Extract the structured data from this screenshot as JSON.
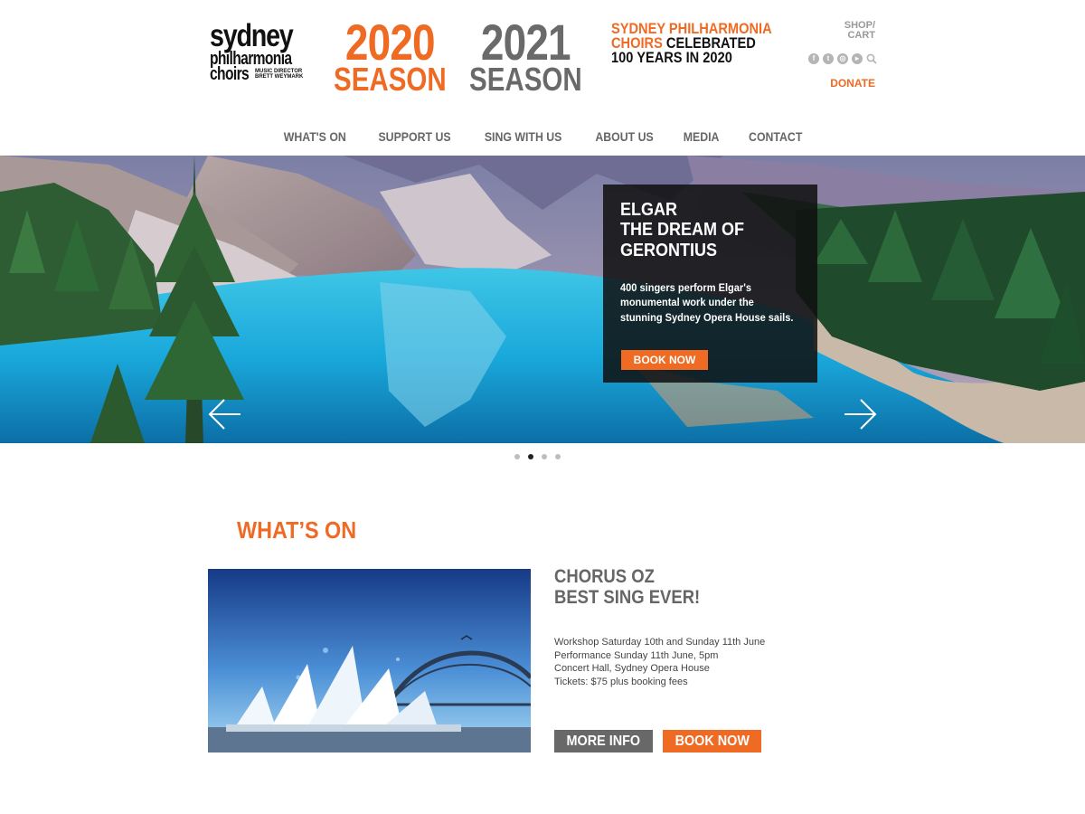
{
  "header": {
    "logo": {
      "line1": "sydney",
      "line2": "philharmonia",
      "line3": "choirs",
      "music_director_line1": "MUSIC DIRECTOR",
      "music_director_line2": "BRETT WEYMARK"
    },
    "seasons": [
      {
        "year": "2020",
        "label": "SEASON",
        "color": "#ef6a23"
      },
      {
        "year": "2021",
        "label": "SEASON",
        "color": "#6a6a6a"
      }
    ],
    "centenary": {
      "line1": "SYDNEY PHILHARMONIA",
      "line2_orange": "CHOIRS",
      "line2_rest": " CELEBRATED",
      "line3": "100 YEARS IN 2020"
    },
    "shop_line1": "SHOP/",
    "shop_line2": "CART",
    "social_icons": [
      "facebook-icon",
      "twitter-icon",
      "instagram-icon",
      "youtube-icon",
      "search-icon"
    ],
    "donate": "DONATE"
  },
  "nav": {
    "items": [
      "WHAT'S ON",
      "SUPPORT US",
      "SING WITH US",
      "ABOUT US",
      "MEDIA",
      "CONTACT"
    ]
  },
  "hero": {
    "title_line1": "ELGAR",
    "title_line2": "THE DREAM OF",
    "title_line3": "GERONTIUS",
    "description_line1": "400 singers perform Elgar's",
    "description_line2": "monumental work under the",
    "description_line3": "stunning Sydney Opera House sails.",
    "button": "BOOK NOW",
    "slide_count": 4,
    "active_slide": 2
  },
  "whats_on": {
    "title": "WHAT’S ON",
    "event": {
      "title_line1": "CHORUS OZ",
      "title_line2": "BEST SING EVER!",
      "details": [
        "Workshop Saturday 10th and Sunday 11th June",
        "Performance Sunday 11th June, 5pm",
        "Concert Hall, Sydney Opera House",
        "Tickets: $75 plus booking fees"
      ],
      "more_info": "MORE INFO",
      "book_now": "BOOK NOW"
    }
  },
  "colors": {
    "accent": "#ef6a23",
    "grey": "#686868"
  }
}
